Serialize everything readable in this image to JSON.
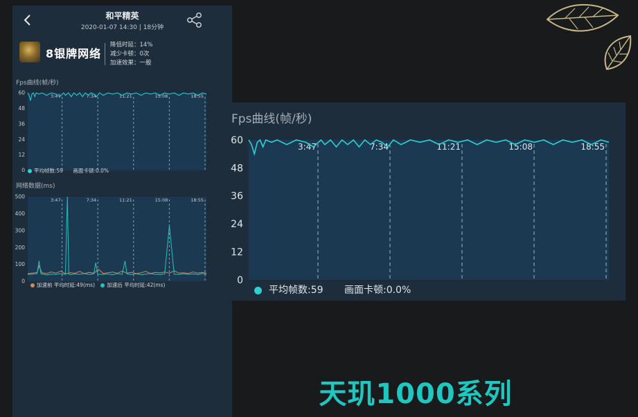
{
  "phone": {
    "header": {
      "title": "和平精英",
      "subtitle": "2020-01-07 14:30 | 18分钟"
    },
    "brand": {
      "name": "8银牌网络"
    },
    "stats": [
      "降低时延：14%",
      "减少卡顿：0次",
      "加速效果：一般"
    ],
    "fps_section": {
      "title": "Fps曲线(帧/秒)",
      "legend": "平均帧数:59",
      "legend2": "画面卡顿:0.0%"
    },
    "net_section": {
      "title": "网络数据(ms)",
      "legend_before": "加速前  平均时延:49(ms)",
      "legend_after": "加速后  平均时延:42(ms)"
    }
  },
  "big_chart": {
    "title": "Fps曲线(帧/秒)",
    "legend_avg": "平均帧数:59",
    "legend_stutter": "画面卡顿:0.0%"
  },
  "caption": "天玑1000系列",
  "colors": {
    "panel": "#1e2d3c",
    "plot": "#1b3a52",
    "fps_line": "#2fd0d0",
    "before_line": "#d08a5a",
    "after_line": "#22c3bd",
    "caption": "#1ec7c0"
  },
  "chart_data": [
    {
      "type": "line",
      "title": "Fps曲线(帧/秒)",
      "ylim": [
        0,
        60
      ],
      "yticks": [
        0,
        12,
        24,
        36,
        48,
        60
      ],
      "xtick_labels": [
        "3:47",
        "7:34",
        "11:21",
        "15:08",
        "18:55"
      ],
      "xlim_minutes": [
        0,
        18.92
      ],
      "series": [
        {
          "x": [
            0,
            0.15,
            0.3,
            0.45,
            0.6,
            0.75,
            0.9,
            1.2,
            1.5,
            2.0,
            2.5,
            3.0,
            3.4,
            3.8,
            4.0,
            4.3,
            4.6,
            4.9,
            5.2,
            5.5,
            5.8,
            6.1,
            6.4,
            6.7,
            7.0,
            7.3,
            7.6,
            8.0,
            8.5,
            9.0,
            9.5,
            10.0,
            10.5,
            11.0,
            11.5,
            12.0,
            12.5,
            13.0,
            13.5,
            14.0,
            14.5,
            15.0,
            15.5,
            16.0,
            16.5,
            17.0,
            17.5,
            18.0,
            18.5,
            18.92
          ],
          "y": [
            60,
            58,
            54,
            59,
            60,
            57,
            60,
            59,
            60,
            58,
            60,
            59,
            57,
            60,
            58,
            60,
            57,
            60,
            58,
            60,
            57,
            60,
            58,
            60,
            59,
            57,
            60,
            58,
            60,
            59,
            60,
            58,
            60,
            59,
            60,
            58,
            60,
            59,
            60,
            58,
            60,
            59,
            60,
            58,
            60,
            59,
            60,
            58,
            60,
            59
          ]
        }
      ],
      "legend": [
        "平均帧数:59",
        "画面卡顿:0.0%"
      ]
    },
    {
      "type": "line",
      "title": "网络数据(ms)",
      "ylim": [
        0,
        500
      ],
      "yticks": [
        0,
        100,
        200,
        300,
        400,
        500
      ],
      "xtick_labels": [
        "3:47",
        "7:34",
        "11:21",
        "15:08",
        "18:55"
      ],
      "xlim_minutes": [
        0,
        18.92
      ],
      "series": [
        {
          "name": "加速前  平均时延:49(ms)",
          "x": [
            0,
            0.5,
            1.0,
            1.2,
            1.5,
            2.0,
            2.5,
            3.0,
            3.5,
            4.0,
            4.5,
            5.0,
            5.5,
            6.0,
            6.5,
            7.0,
            7.5,
            8.0,
            8.5,
            9.0,
            9.5,
            10.0,
            10.5,
            11.0,
            11.5,
            12.0,
            12.5,
            13.0,
            13.5,
            14.0,
            14.5,
            15.0,
            15.5,
            16.0,
            16.5,
            17.0,
            17.5,
            18.0,
            18.5,
            18.92
          ],
          "y": [
            45,
            48,
            52,
            90,
            50,
            46,
            55,
            48,
            60,
            44,
            50,
            47,
            58,
            45,
            52,
            48,
            70,
            46,
            50,
            54,
            47,
            60,
            48,
            52,
            45,
            50,
            58,
            46,
            52,
            49,
            55,
            47,
            62,
            48,
            50,
            46,
            55,
            48,
            52,
            47
          ]
        },
        {
          "name": "加速后  平均时延:42(ms)",
          "x": [
            0,
            0.5,
            1.0,
            1.2,
            1.4,
            2.0,
            2.5,
            3.0,
            3.5,
            4.0,
            4.2,
            4.35,
            4.5,
            5.0,
            5.5,
            6.0,
            6.5,
            7.0,
            7.2,
            7.4,
            8.0,
            8.5,
            9.0,
            9.5,
            10.0,
            10.3,
            10.5,
            11.0,
            11.5,
            12.0,
            12.5,
            13.0,
            13.5,
            14.0,
            14.5,
            15.0,
            15.5,
            16.0,
            16.5,
            17.0,
            17.5,
            18.0,
            18.5,
            18.92
          ],
          "y": [
            40,
            42,
            45,
            120,
            44,
            38,
            42,
            40,
            45,
            41,
            500,
            42,
            39,
            43,
            41,
            45,
            40,
            44,
            110,
            42,
            40,
            43,
            39,
            45,
            41,
            120,
            43,
            40,
            44,
            39,
            42,
            45,
            41,
            40,
            43,
            330,
            42,
            40,
            44,
            41,
            43,
            40,
            45,
            42
          ]
        }
      ]
    },
    {
      "type": "line",
      "title": "Fps曲线(帧/秒)",
      "ylim": [
        0,
        60
      ],
      "yticks": [
        0,
        12,
        24,
        36,
        48,
        60
      ],
      "xtick_labels": [
        "3:47",
        "7:34",
        "11:21",
        "15:08",
        "18:55"
      ],
      "xlim_minutes": [
        0,
        18.92
      ],
      "series": [
        {
          "x": [
            0,
            0.15,
            0.3,
            0.45,
            0.6,
            0.75,
            0.9,
            1.2,
            1.5,
            2.0,
            2.5,
            3.0,
            3.4,
            3.8,
            4.0,
            4.3,
            4.6,
            4.9,
            5.2,
            5.5,
            5.8,
            6.1,
            6.4,
            6.7,
            7.0,
            7.3,
            7.6,
            8.0,
            8.5,
            9.0,
            9.5,
            10.0,
            10.5,
            11.0,
            11.5,
            12.0,
            12.5,
            13.0,
            13.5,
            14.0,
            14.5,
            15.0,
            15.5,
            16.0,
            16.5,
            17.0,
            17.5,
            18.0,
            18.5,
            18.92
          ],
          "y": [
            60,
            58,
            54,
            59,
            60,
            57,
            60,
            59,
            60,
            58,
            60,
            59,
            57,
            60,
            58,
            60,
            57,
            60,
            58,
            60,
            57,
            60,
            58,
            60,
            59,
            57,
            60,
            58,
            60,
            59,
            60,
            58,
            60,
            59,
            60,
            58,
            60,
            59,
            60,
            58,
            60,
            59,
            60,
            58,
            60,
            59,
            60,
            58,
            60,
            59
          ]
        }
      ],
      "legend": [
        "平均帧数:59",
        "画面卡顿:0.0%"
      ]
    }
  ]
}
